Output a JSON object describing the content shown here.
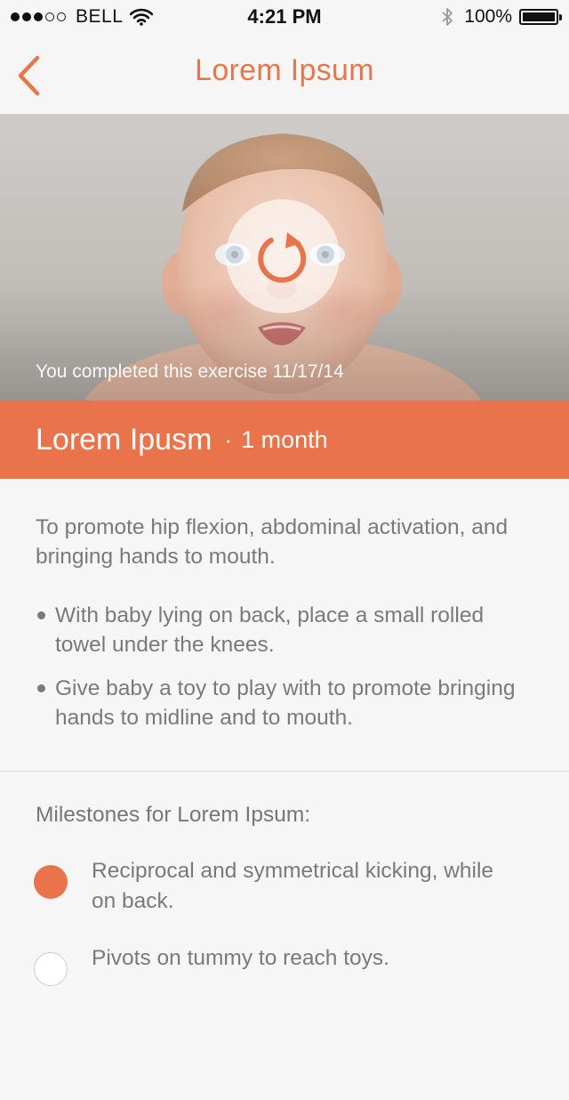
{
  "status_bar": {
    "carrier": "BELL",
    "time": "4:21 PM",
    "battery": "100%",
    "signal_full": 3,
    "signal_total": 5
  },
  "nav": {
    "title": "Lorem Ipsum",
    "back_icon": "chevron-left-icon"
  },
  "hero": {
    "completed_text": "You completed this exercise 11/17/14",
    "replay_icon": "replay-icon"
  },
  "banner": {
    "title": "Lorem Ipusm",
    "separator": "·",
    "age": "1 month"
  },
  "exercise": {
    "description": "To promote hip flexion, abdominal activation, and bringing hands to mouth.",
    "steps": [
      "With baby lying on back, place a small rolled towel under the knees.",
      "Give baby a toy to play with to promote bringing hands to midline and to mouth."
    ]
  },
  "milestones": {
    "heading": "Milestones for Lorem Ipsum:",
    "items": [
      {
        "label": "Reciprocal and symmetrical kicking, while on back.",
        "completed": true
      },
      {
        "label": "Pivots on tummy to reach toys.",
        "completed": false
      }
    ]
  },
  "colors": {
    "accent": "#e9744c",
    "background": "#f6f6f6",
    "text": "#7a7a7a"
  }
}
